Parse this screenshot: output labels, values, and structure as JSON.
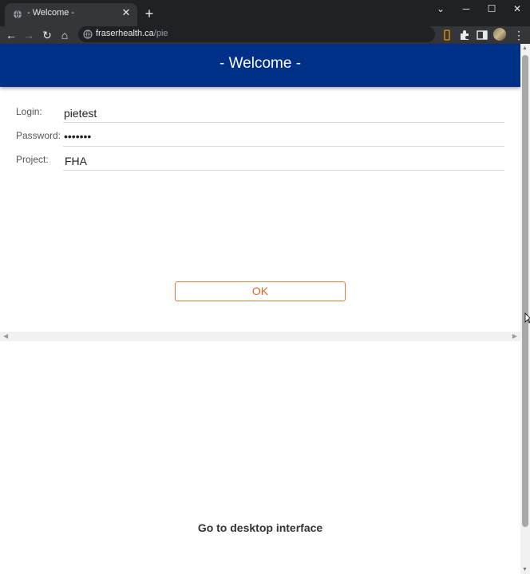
{
  "browser": {
    "tab_title": "- Welcome -",
    "tab_close": "✕",
    "new_tab": "+",
    "url_host": "fraserhealth.ca",
    "url_path": "/pie",
    "window_controls": {
      "collapse": "⌄",
      "minimize": "─",
      "maximize": "☐",
      "close": "✕"
    },
    "nav": {
      "back": "←",
      "forward": "→",
      "reload": "↻",
      "home": "⌂"
    },
    "menu": "⋮",
    "icons": [
      "globe-icon",
      "lock-icon",
      "extension-icon",
      "puzzle-icon",
      "sidepanel-icon",
      "avatar"
    ]
  },
  "page": {
    "header_title": "- Welcome -",
    "header_color": "#003087",
    "form": {
      "login_label": "Login:",
      "login_value": "pietest",
      "password_label": "Password:",
      "password_value": "•••••••",
      "project_label": "Project:",
      "project_value": "FHA"
    },
    "ok_label": "OK",
    "accent_color": "#e07b39",
    "desktop_link": "Go to desktop interface"
  }
}
